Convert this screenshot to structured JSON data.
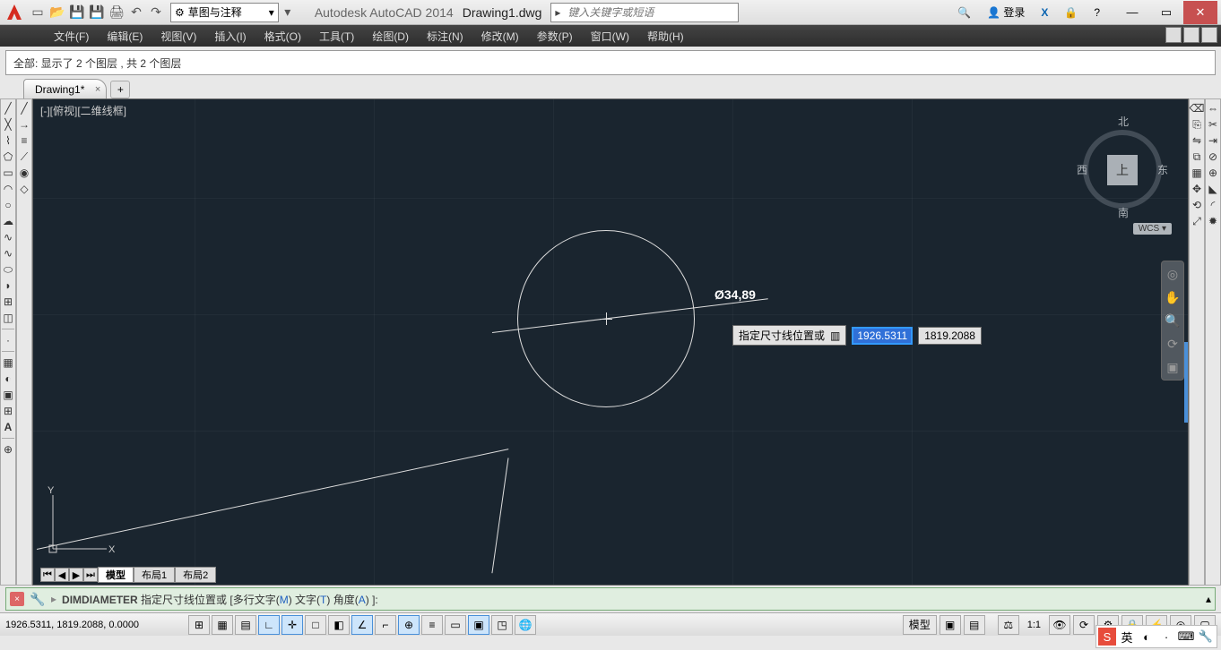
{
  "titlebar": {
    "app": "Autodesk AutoCAD 2014",
    "document": "Drawing1.dwg",
    "workspace": "草图与注释",
    "search_placeholder": "键入关键字或短语",
    "login": "登录"
  },
  "menu": {
    "items": [
      "文件(F)",
      "编辑(E)",
      "视图(V)",
      "插入(I)",
      "格式(O)",
      "工具(T)",
      "绘图(D)",
      "标注(N)",
      "修改(M)",
      "参数(P)",
      "窗口(W)",
      "帮助(H)"
    ]
  },
  "layer_row": "全部: 显示了 2 个图层 , 共 2 个图层",
  "doc_tabs": {
    "active": "Drawing1*"
  },
  "viewport": {
    "label": "[-][俯视][二维线框]"
  },
  "viewcube": {
    "face": "上",
    "n": "北",
    "s": "南",
    "e": "东",
    "w": "西",
    "wcs": "WCS ▾"
  },
  "canvas": {
    "dim_label": "Ø34,89",
    "tooltip": "指定尺寸线位置或",
    "coord_x": "1926.5311",
    "coord_y": "1819.2088"
  },
  "layout_tabs": {
    "model": "模型",
    "l1": "布局1",
    "l2": "布局2"
  },
  "cmdline": {
    "command": "DIMDIAMETER",
    "text_prefix": "指定尺寸线位置或 [多行文字(",
    "m": "M",
    "mid1": ") 文字(",
    "t": "T",
    "mid2": ") 角度(",
    "a": "A",
    "suffix": ") ]:"
  },
  "statusbar": {
    "coords": "1926.5311, 1819.2088, 0.0000",
    "model": "模型",
    "scale": "1:1",
    "ime": "英"
  },
  "left_tools": [
    "line",
    "cline",
    "pline",
    "polygon",
    "rect",
    "arc",
    "circle",
    "rev",
    "spline",
    "spline2",
    "ellipse",
    "earc",
    "block",
    "point",
    "hatch",
    "grad",
    "region",
    "table",
    "text"
  ],
  "right_tools": [
    "move",
    "copy",
    "stretch",
    "rotate",
    "mirror",
    "scale",
    "trim",
    "extend"
  ]
}
